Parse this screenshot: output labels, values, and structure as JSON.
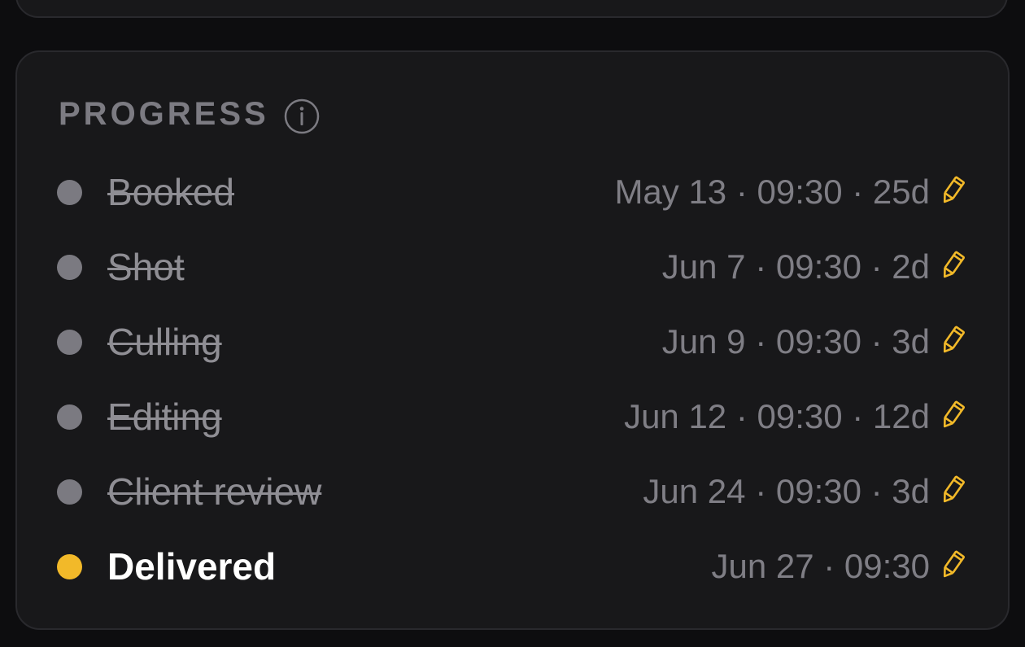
{
  "section": {
    "title": "PROGRESS"
  },
  "colors": {
    "accent": "#f2b929",
    "done_dot": "#7b7a81",
    "card_bg": "#18181a"
  },
  "steps": [
    {
      "label": "Booked",
      "meta": "May 13 · 09:30 · 25d",
      "done": true
    },
    {
      "label": "Shot",
      "meta": "Jun 7 · 09:30 · 2d",
      "done": true
    },
    {
      "label": "Culling",
      "meta": "Jun 9 · 09:30 · 3d",
      "done": true
    },
    {
      "label": "Editing",
      "meta": "Jun 12 · 09:30 · 12d",
      "done": true
    },
    {
      "label": "Client review",
      "meta": "Jun 24 · 09:30 · 3d",
      "done": true
    },
    {
      "label": "Delivered",
      "meta": "Jun 27 · 09:30",
      "done": false
    }
  ]
}
